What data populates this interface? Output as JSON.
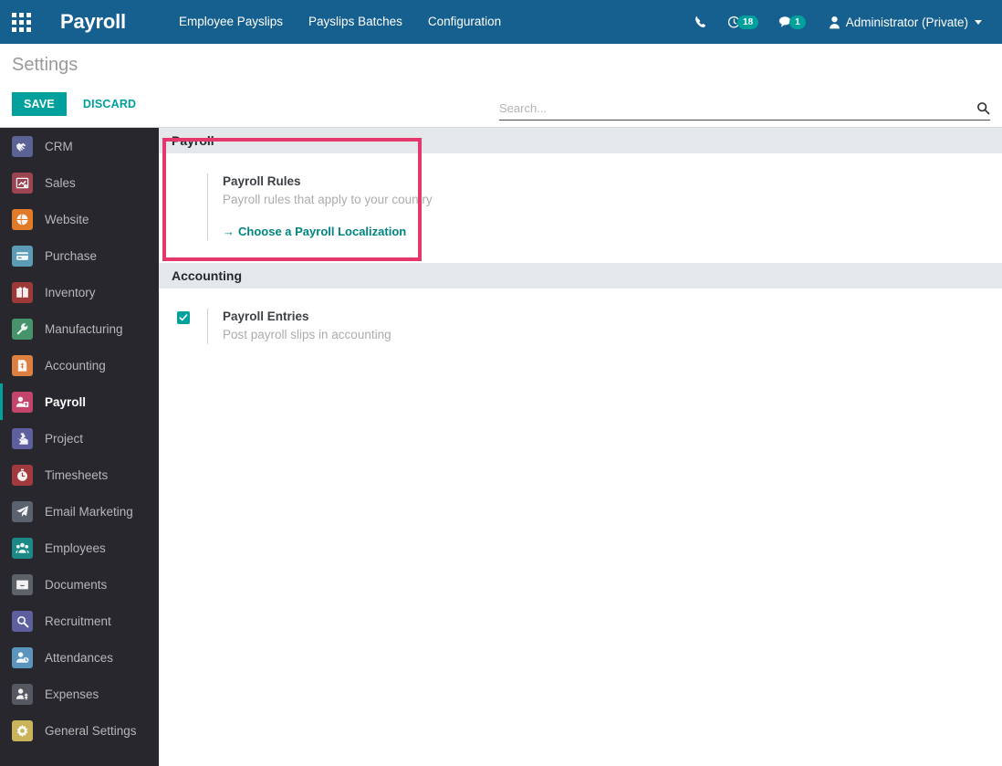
{
  "navbar": {
    "apps_icon": "apps-grid-icon",
    "brand": "Payroll",
    "menu": [
      {
        "label": "Employee Payslips"
      },
      {
        "label": "Payslips Batches"
      },
      {
        "label": "Configuration"
      }
    ],
    "phone_icon": "phone-icon",
    "activity_icon": "activity-clock-icon",
    "activity_count": "18",
    "messages_icon": "messages-chat-icon",
    "messages_count": "1",
    "avatar_icon": "user-avatar-icon",
    "user_name": "Administrator (Private)",
    "accent_color": "#16608f",
    "badge_color": "#00a09d"
  },
  "control_panel": {
    "title": "Settings",
    "save_label": "SAVE",
    "discard_label": "DISCARD",
    "search_placeholder": "Search...",
    "search_value": "",
    "search_icon": "search-icon",
    "primary_color": "#00a09d"
  },
  "sidebar": {
    "active": "Payroll",
    "items": [
      {
        "label": "CRM",
        "icon": "crm-handshake-icon",
        "color": "#5b6294"
      },
      {
        "label": "Sales",
        "icon": "sales-chart-icon",
        "color": "#9c4551"
      },
      {
        "label": "Website",
        "icon": "website-globe-icon",
        "color": "#e07b2a"
      },
      {
        "label": "Purchase",
        "icon": "purchase-card-icon",
        "color": "#5b9bb5"
      },
      {
        "label": "Inventory",
        "icon": "inventory-box-icon",
        "color": "#9c3a3a"
      },
      {
        "label": "Manufacturing",
        "icon": "manufacturing-wrench-icon",
        "color": "#46936c"
      },
      {
        "label": "Accounting",
        "icon": "accounting-invoice-icon",
        "color": "#db8040"
      },
      {
        "label": "Payroll",
        "icon": "payroll-person-icon",
        "color": "#c4456b"
      },
      {
        "label": "Project",
        "icon": "project-puzzle-icon",
        "color": "#5d5f9e"
      },
      {
        "label": "Timesheets",
        "icon": "timesheets-timer-icon",
        "color": "#a13a3f"
      },
      {
        "label": "Email Marketing",
        "icon": "email-send-icon",
        "color": "#5a6270"
      },
      {
        "label": "Employees",
        "icon": "employees-group-icon",
        "color": "#1b8a86"
      },
      {
        "label": "Documents",
        "icon": "documents-folder-icon",
        "color": "#5d6168"
      },
      {
        "label": "Recruitment",
        "icon": "recruitment-search-icon",
        "color": "#5d5f9e"
      },
      {
        "label": "Attendances",
        "icon": "attendances-person-icon",
        "color": "#5b94bd"
      },
      {
        "label": "Expenses",
        "icon": "expenses-dollar-icon",
        "color": "#555860"
      },
      {
        "label": "General Settings",
        "icon": "settings-gear-icon",
        "color": "#c9b45c"
      }
    ]
  },
  "main": {
    "highlight_color": "#e4376c",
    "sections": [
      {
        "title": "Payroll",
        "settings": [
          {
            "name": "Payroll Rules",
            "description": "Payroll rules that apply to your country",
            "link_label": "Choose a Payroll Localization",
            "link_arrow": "→",
            "has_checkbox": false,
            "highlighted": true
          }
        ]
      },
      {
        "title": "Accounting",
        "settings": [
          {
            "name": "Payroll Entries",
            "description": "Post payroll slips in accounting",
            "has_checkbox": true,
            "checked": true,
            "highlighted": false
          }
        ]
      }
    ]
  }
}
